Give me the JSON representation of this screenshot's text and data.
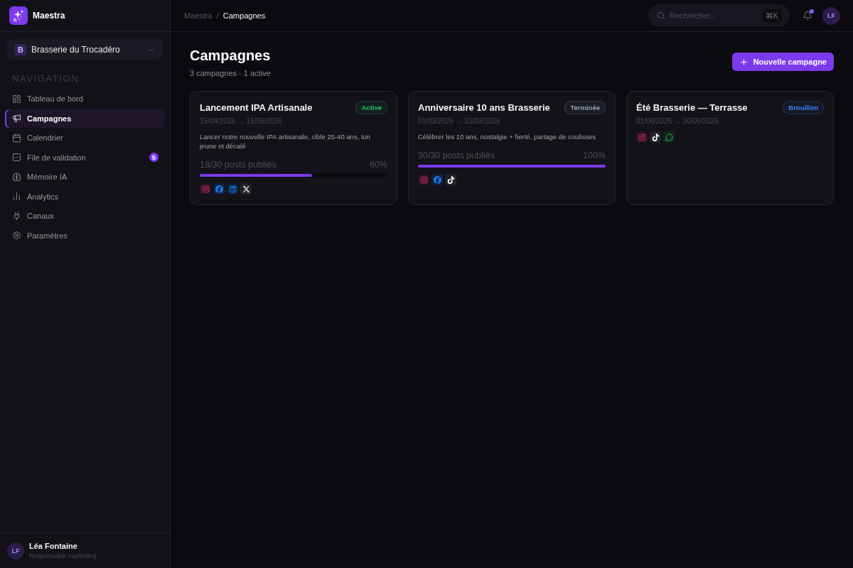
{
  "app": {
    "name": "Maestra"
  },
  "sidebar": {
    "workspace": {
      "initial": "B",
      "name": "Brasserie du Trocadéro"
    },
    "section_title": "NAVIGATION",
    "items": [
      {
        "label": "Tableau de bord",
        "selected": false
      },
      {
        "label": "Campagnes",
        "selected": true
      },
      {
        "label": "Calendrier",
        "selected": false
      },
      {
        "label": "File de validation",
        "selected": false,
        "badge": "5"
      },
      {
        "label": "Mémoire IA",
        "selected": false
      },
      {
        "label": "Analytics",
        "selected": false
      },
      {
        "label": "Canaux",
        "selected": false
      },
      {
        "label": "Paramètres",
        "selected": false
      }
    ],
    "user": {
      "initials": "LF",
      "name": "Léa Fontaine",
      "role": "Responsable marketing"
    }
  },
  "header": {
    "breadcrumb": {
      "items": [
        "Maestra",
        "Campagnes"
      ],
      "separator": "/"
    },
    "search": {
      "placeholder": "Rechercher...",
      "shortcut": "⌘K"
    },
    "notifications": {
      "unread": true
    },
    "user_initials": "LF"
  },
  "page": {
    "title": "Campagnes",
    "subtitle": "3 campagnes · 1 active",
    "new_button": "Nouvelle campagne"
  },
  "campaigns": [
    {
      "title": "Lancement IPA Artisanale",
      "status": {
        "label": "Active",
        "color": "#22c55e"
      },
      "dates": "15/04/2026 → 15/05/2026",
      "description": "Lancer notre nouvelle IPA artisanale, cible 25-40 ans, ton jeune et décalé",
      "progress": {
        "label": "18/30 posts publiés",
        "percent": "60%",
        "level": 0.6
      },
      "channels": [
        {
          "kind": "instagram"
        },
        {
          "kind": "facebook"
        },
        {
          "kind": "linkedin"
        },
        {
          "kind": "x"
        }
      ]
    },
    {
      "title": "Anniversaire 10 ans Brasserie",
      "status": {
        "label": "Terminée",
        "color": "#9ca3af"
      },
      "dates": "01/03/2026 → 31/03/2026",
      "description": "Célébrer les 10 ans, nostalgie + fierté, partage de coulisses",
      "progress": {
        "label": "30/30 posts publiés",
        "percent": "100%",
        "level": 1
      },
      "channels": [
        {
          "kind": "instagram"
        },
        {
          "kind": "facebook"
        },
        {
          "kind": "tiktok"
        }
      ]
    },
    {
      "title": "Été Brasserie — Terrasse",
      "status": {
        "label": "Brouillon",
        "color": "#3b82f6"
      },
      "dates": "01/06/2026 → 30/06/2026",
      "channels": [
        {
          "kind": "instagram"
        },
        {
          "kind": "tiktok"
        },
        {
          "kind": "chat"
        }
      ]
    }
  ]
}
